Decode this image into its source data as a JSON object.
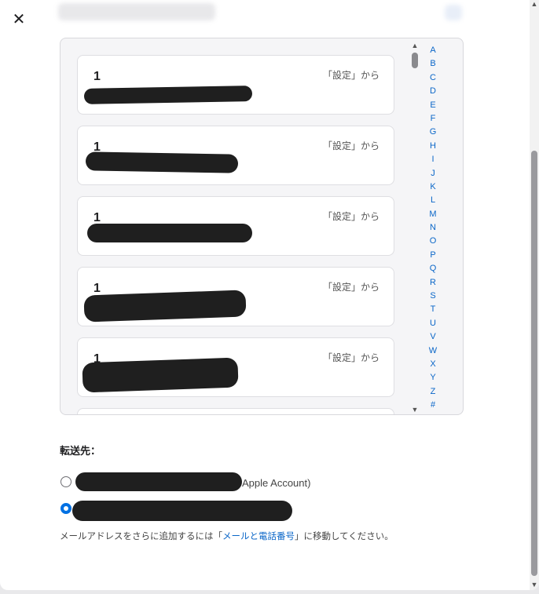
{
  "dialog": {
    "close_glyph": "✕"
  },
  "items": [
    {
      "count": "1",
      "source": "「設定」から"
    },
    {
      "count": "1",
      "source": "「設定」から"
    },
    {
      "count": "1",
      "source": "「設定」から"
    },
    {
      "count": "1",
      "source": "「設定」から"
    },
    {
      "count": "1",
      "source": "「設定」から"
    }
  ],
  "alphabet": [
    "A",
    "B",
    "C",
    "D",
    "E",
    "F",
    "G",
    "H",
    "I",
    "J",
    "K",
    "L",
    "M",
    "N",
    "O",
    "P",
    "Q",
    "R",
    "S",
    "T",
    "U",
    "V",
    "W",
    "X",
    "Y",
    "Z",
    "#"
  ],
  "scroll_glyphs": {
    "up": "▲",
    "down": "▼"
  },
  "forward": {
    "label": "転送先：",
    "options": [
      {
        "suffix": "Apple Account)",
        "selected": false
      },
      {
        "suffix": "",
        "selected": true
      }
    ]
  },
  "help": {
    "prefix": "メールアドレスをさらに追加するには「",
    "link": "メールと電話番号",
    "suffix": "」に移動してください。"
  },
  "colors": {
    "accent": "#0071e3",
    "link": "#0a66c8",
    "redaction": "#1f1f1f"
  }
}
